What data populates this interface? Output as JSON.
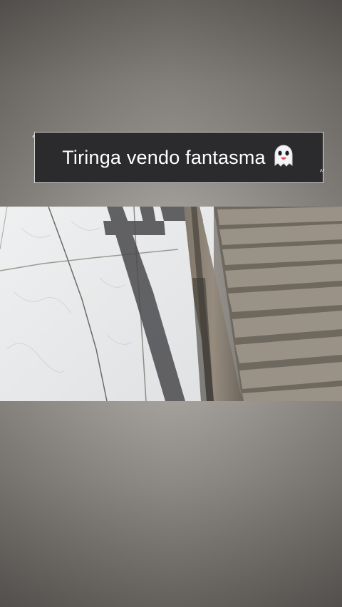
{
  "caption": {
    "text": "Tiringa vendo fantasma",
    "emoji_icon": "ghost-icon",
    "open_quote": "“",
    "close_quote": "”"
  },
  "colors": {
    "caption_bg": "#2b2b2d",
    "caption_text": "#ffffff",
    "tile_floor": "#e8e9ea",
    "wood": "#8a8174",
    "shadow": "#4a4a4d"
  }
}
